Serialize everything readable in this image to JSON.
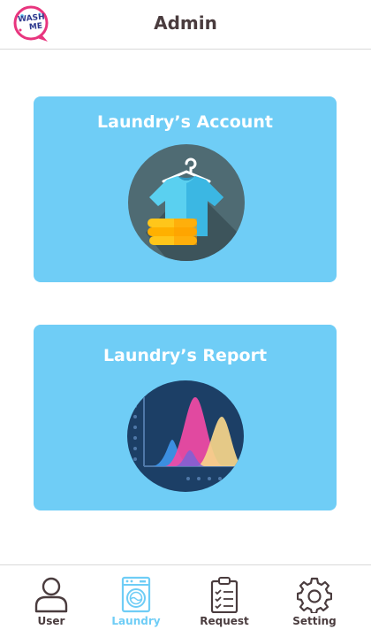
{
  "header": {
    "title": "Admin",
    "logo_line1": "WASH",
    "logo_line2": "ME"
  },
  "cards": [
    {
      "title": "Laundry’s Account",
      "icon": "shirt-hanger-icon"
    },
    {
      "title": "Laundry’s Report",
      "icon": "report-chart-icon"
    }
  ],
  "nav": [
    {
      "label": "User",
      "icon": "user-icon",
      "active": false
    },
    {
      "label": "Laundry",
      "icon": "washing-machine-icon",
      "active": true
    },
    {
      "label": "Request",
      "icon": "clipboard-check-icon",
      "active": false
    },
    {
      "label": "Setting",
      "icon": "gear-icon",
      "active": false
    }
  ],
  "colors": {
    "card": "#6fcdf6",
    "active_nav": "#6fcdf6",
    "text_dark": "#4a3c3e",
    "logo_pink": "#e8357e"
  }
}
